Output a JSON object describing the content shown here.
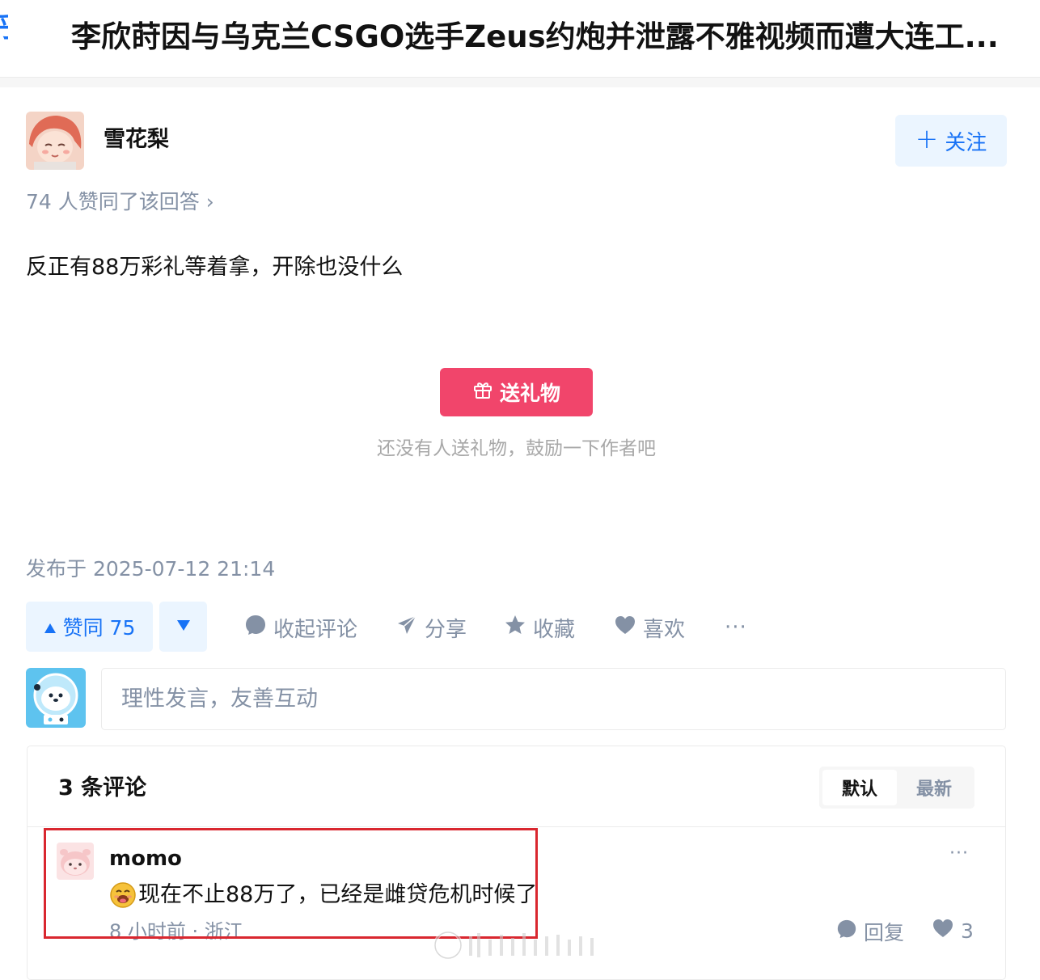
{
  "header": {
    "question_title": "李欣莳因与乌克兰CSGO选手Zeus约炮并泄露不雅视频而遭大连工..."
  },
  "author": {
    "name": "雪花梨",
    "follow_label": "关注",
    "voters_text": "74 人赞同了该回答 ›"
  },
  "answer": {
    "text": "反正有88万彩礼等着拿，开除也没什么",
    "gift_label": "送礼物",
    "gift_hint": "还没有人送礼物，鼓励一下作者吧",
    "publish_time": "发布于 2025-07-12 21:14"
  },
  "actions": {
    "vote_up_label": "赞同 75",
    "collapse_comments": "收起评论",
    "share": "分享",
    "favorite": "收藏",
    "like": "喜欢",
    "more": "···"
  },
  "comment_box": {
    "placeholder": "理性发言，友善互动"
  },
  "comments": {
    "count_label": "3 条评论",
    "sort_default": "默认",
    "sort_latest": "最新",
    "items": [
      {
        "author": "momo",
        "text": "现在不止88万了，已经是雌贷危机时候了",
        "time_location": "8 小时前 · 浙江",
        "reply_label": "回复",
        "like_count": "3",
        "more": "···"
      }
    ]
  },
  "colors": {
    "brand_blue": "#1772f6",
    "gift_pink": "#f1456b",
    "muted_text": "#8491a5",
    "highlight_red": "#d9272f"
  },
  "icons": [
    "plus-icon",
    "gift-icon",
    "triangle-up-icon",
    "triangle-down-icon",
    "comment-bubble-icon",
    "paper-plane-icon",
    "star-icon",
    "heart-icon",
    "more-dots-icon",
    "reply-bubble-icon",
    "emoji-drooling-icon"
  ]
}
